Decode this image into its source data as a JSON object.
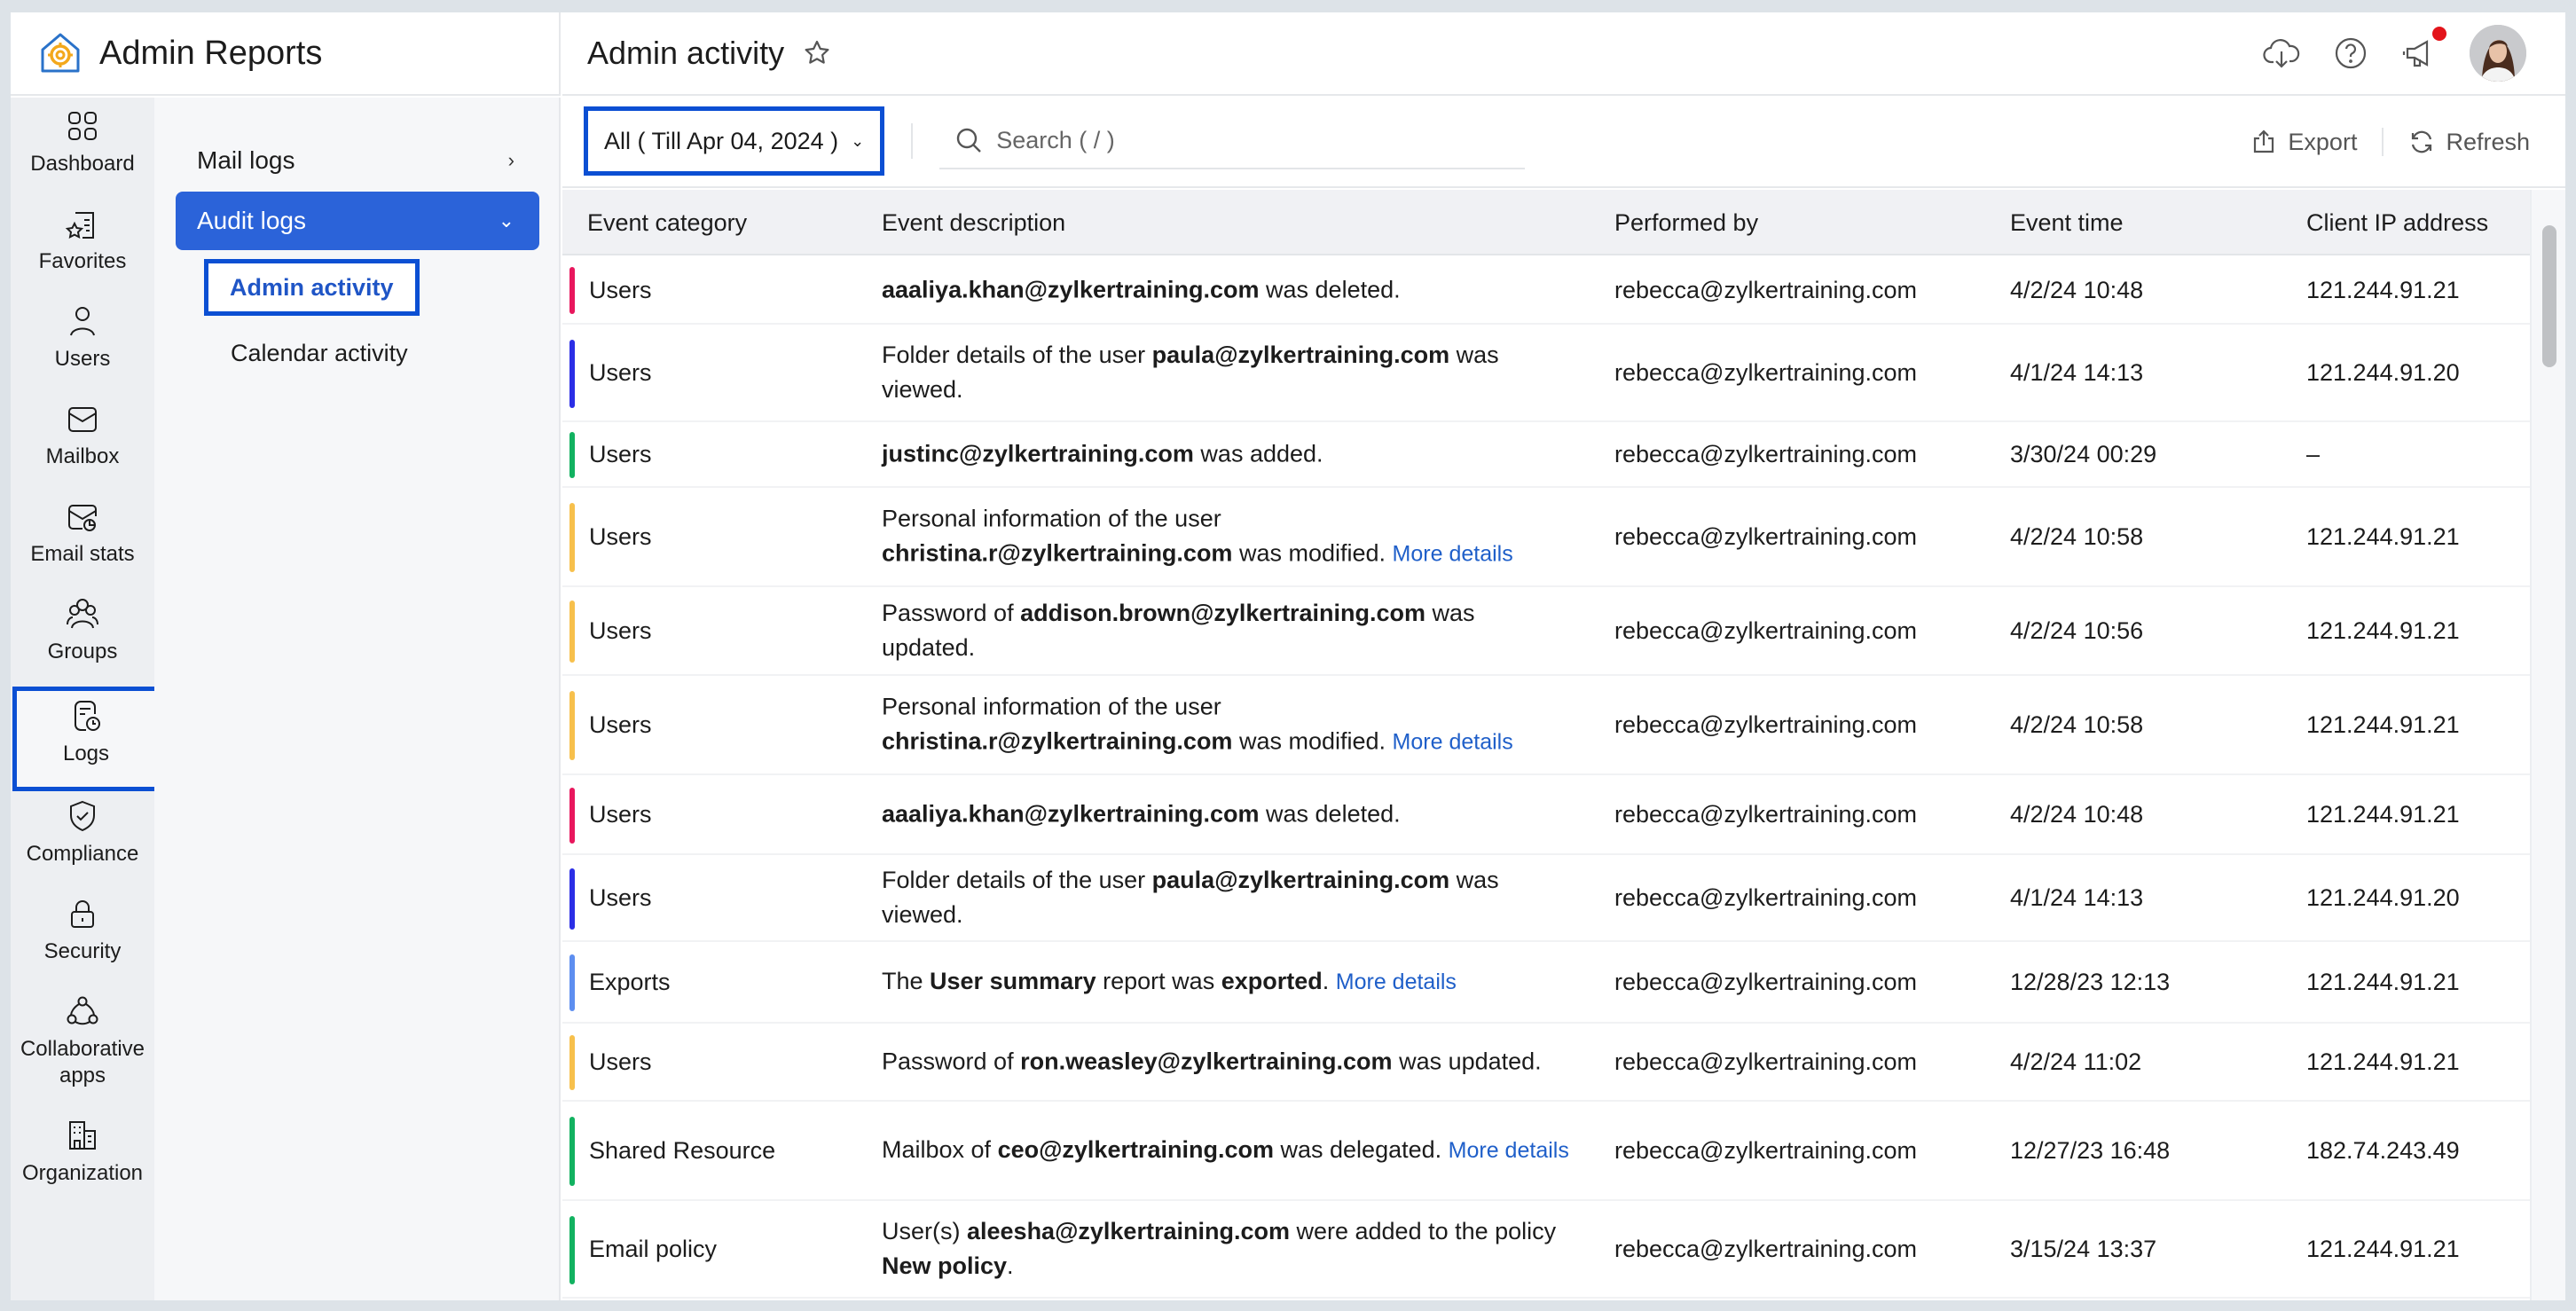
{
  "app": {
    "title": "Admin Reports"
  },
  "rail": {
    "items": [
      {
        "label": "Dashboard",
        "icon": "dashboard-grid-icon"
      },
      {
        "label": "Favorites",
        "icon": "favorites-list-icon"
      },
      {
        "label": "Users",
        "icon": "user-icon"
      },
      {
        "label": "Mailbox",
        "icon": "mailbox-icon"
      },
      {
        "label": "Email stats",
        "icon": "email-stats-icon"
      },
      {
        "label": "Groups",
        "icon": "groups-icon"
      },
      {
        "label": "Logs",
        "icon": "logs-icon",
        "active": true
      },
      {
        "label": "Compliance",
        "icon": "shield-check-icon"
      },
      {
        "label": "Security",
        "icon": "lock-icon"
      },
      {
        "label": "Collaborative apps",
        "label_line1": "Collaborative",
        "label_line2": "apps",
        "icon": "collaborative-apps-icon"
      },
      {
        "label": "Organization",
        "icon": "building-icon"
      }
    ]
  },
  "submenu": {
    "mail_logs": "Mail logs",
    "audit_logs": "Audit logs",
    "audit_children": [
      "Admin activity",
      "Calendar activity"
    ],
    "active_child": "Admin activity"
  },
  "header": {
    "page_title": "Admin activity",
    "icons": [
      "cloud-download-icon",
      "help-icon",
      "announcement-icon",
      "avatar"
    ],
    "notification_dot_color": "#e3141b"
  },
  "toolbar": {
    "filter_value": "All ( Till Apr 04, 2024 )",
    "search_placeholder": "Search ( / )",
    "export_label": "Export",
    "refresh_label": "Refresh"
  },
  "table": {
    "columns": [
      "Event category",
      "Event description",
      "Performed by",
      "Event time",
      "Client IP address"
    ],
    "rows": [
      {
        "category": "Users",
        "color": "#e8175d",
        "desc_html": "<b>aaaliya.khan@zylkertraining.com</b> was deleted.",
        "more": "",
        "performed_by": "rebecca@zylkertraining.com",
        "time": "4/2/24 10:48",
        "ip": "121.244.91.21"
      },
      {
        "category": "Users",
        "color": "#2b2ee6",
        "desc_html": "Folder details of the user <b>paula@zylkertraining.com</b> was viewed.",
        "more": "",
        "performed_by": "rebecca@zylkertraining.com",
        "time": "4/1/24 14:13",
        "ip": "121.244.91.20"
      },
      {
        "category": "Users",
        "color": "#12b260",
        "desc_html": "<b>justinc@zylkertraining.com</b> was added.",
        "more": "",
        "performed_by": "rebecca@zylkertraining.com",
        "time": "3/30/24 00:29",
        "ip": "–"
      },
      {
        "category": "Users",
        "color": "#f7c04c",
        "desc_html": "Personal information of the user <b>christina.r@zylkertraining.com</b> was modified.",
        "more": "More details",
        "performed_by": "rebecca@zylkertraining.com",
        "time": "4/2/24 10:58",
        "ip": "121.244.91.21"
      },
      {
        "category": "Users",
        "color": "#f7c04c",
        "desc_html": "Password of <b>addison.brown@zylkertraining.com</b> was updated.",
        "more": "",
        "performed_by": "rebecca@zylkertraining.com",
        "time": "4/2/24 10:56",
        "ip": "121.244.91.21"
      },
      {
        "category": "Users",
        "color": "#f7c04c",
        "desc_html": "Personal information of the user <b>christina.r@zylkertraining.com</b> was modified.",
        "more": "More details",
        "performed_by": "rebecca@zylkertraining.com",
        "time": "4/2/24 10:58",
        "ip": "121.244.91.21"
      },
      {
        "category": "Users",
        "color": "#e8175d",
        "desc_html": "<b>aaaliya.khan@zylkertraining.com</b> was deleted.",
        "more": "",
        "performed_by": "rebecca@zylkertraining.com",
        "time": "4/2/24 10:48",
        "ip": "121.244.91.21"
      },
      {
        "category": "Users",
        "color": "#2b2ee6",
        "desc_html": "Folder details of the user <b>paula@zylkertraining.com</b> was viewed.",
        "more": "",
        "performed_by": "rebecca@zylkertraining.com",
        "time": "4/1/24 14:13",
        "ip": "121.244.91.20"
      },
      {
        "category": "Exports",
        "color": "#5d8ef0",
        "desc_html": "The <b>User summary</b> report was <b>exported</b>.",
        "more": "More details",
        "performed_by": "rebecca@zylkertraining.com",
        "time": "12/28/23 12:13",
        "ip": "121.244.91.21"
      },
      {
        "category": "Users",
        "color": "#f7c04c",
        "desc_html": "Password of <b>ron.weasley@zylkertraining.com</b> was updated.",
        "more": "",
        "performed_by": "rebecca@zylkertraining.com",
        "time": "4/2/24 11:02",
        "ip": "121.244.91.21"
      },
      {
        "category": "Shared Resource",
        "color": "#12b260",
        "desc_html": "Mailbox of <b>ceo@zylkertraining.com</b> was delegated.",
        "more": "More details",
        "performed_by": "rebecca@zylkertraining.com",
        "time": "12/27/23 16:48",
        "ip": "182.74.243.49"
      },
      {
        "category": "Email policy",
        "color": "#12b260",
        "desc_html": "User(s) <b>aleesha@zylkertraining.com</b> were added to the policy <b>New policy</b>.",
        "more": "",
        "performed_by": "rebecca@zylkertraining.com",
        "time": "3/15/24 13:37",
        "ip": "121.244.91.21"
      }
    ]
  },
  "colors": {
    "accent": "#2b63d9",
    "highlight_border": "#0b4fd3",
    "link": "#1f5fc9"
  }
}
